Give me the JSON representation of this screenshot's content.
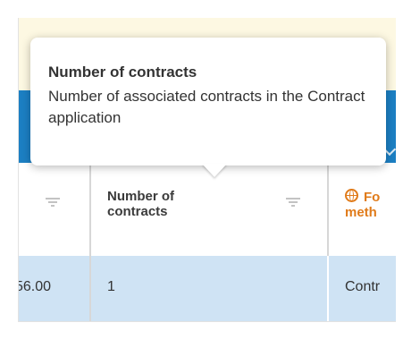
{
  "grid": {
    "columns": [
      {
        "label": ""
      },
      {
        "label": "Number of contracts"
      },
      {
        "label": "Fo\nmeth"
      }
    ],
    "row": {
      "amount": "56.00",
      "contracts": "1",
      "contract_link": "Contr"
    }
  },
  "tooltip": {
    "title": "Number of contracts",
    "body": "Number of associated contracts in the Contract application"
  },
  "colors": {
    "banner": "#fdf8e2",
    "header_bar": "#1c7fc3",
    "selected_row": "#cfe3f4",
    "accent_orange": "#e07b1a"
  },
  "icons": {
    "filter": "filter-icon",
    "globe": "globe-icon",
    "chevron": "chevron-down-icon"
  }
}
